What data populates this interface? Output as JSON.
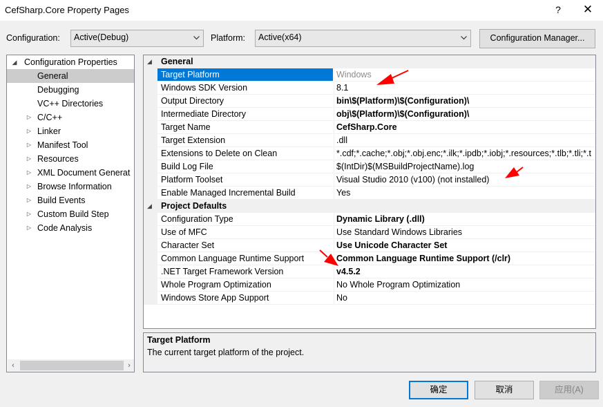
{
  "window": {
    "title": "CefSharp.Core Property Pages",
    "help_label": "?",
    "close_label": "✕"
  },
  "toolbar": {
    "configuration_label": "Configuration:",
    "configuration_value": "Active(Debug)",
    "platform_label": "Platform:",
    "platform_value": "Active(x64)",
    "config_manager_label": "Configuration Manager..."
  },
  "tree": {
    "root": "Configuration Properties",
    "items": [
      {
        "label": "General",
        "selected": true,
        "expandable": false
      },
      {
        "label": "Debugging",
        "expandable": false
      },
      {
        "label": "VC++ Directories",
        "expandable": false
      },
      {
        "label": "C/C++",
        "expandable": true
      },
      {
        "label": "Linker",
        "expandable": true
      },
      {
        "label": "Manifest Tool",
        "expandable": true
      },
      {
        "label": "Resources",
        "expandable": true
      },
      {
        "label": "XML Document Generat",
        "expandable": true
      },
      {
        "label": "Browse Information",
        "expandable": true
      },
      {
        "label": "Build Events",
        "expandable": true
      },
      {
        "label": "Custom Build Step",
        "expandable": true
      },
      {
        "label": "Code Analysis",
        "expandable": true
      }
    ]
  },
  "grid": {
    "categories": [
      {
        "name": "General",
        "rows": [
          {
            "name": "Target Platform",
            "value": "Windows",
            "style": "dim",
            "selected": true
          },
          {
            "name": "Windows SDK Version",
            "value": "8.1"
          },
          {
            "name": "Output Directory",
            "value": "bin\\$(Platform)\\$(Configuration)\\",
            "style": "bold"
          },
          {
            "name": "Intermediate Directory",
            "value": "obj\\$(Platform)\\$(Configuration)\\",
            "style": "bold"
          },
          {
            "name": "Target Name",
            "value": "CefSharp.Core",
            "style": "bold"
          },
          {
            "name": "Target Extension",
            "value": ".dll"
          },
          {
            "name": "Extensions to Delete on Clean",
            "value": "*.cdf;*.cache;*.obj;*.obj.enc;*.ilk;*.ipdb;*.iobj;*.resources;*.tlb;*.tli;*.t"
          },
          {
            "name": "Build Log File",
            "value": "$(IntDir)$(MSBuildProjectName).log"
          },
          {
            "name": "Platform Toolset",
            "value": "Visual Studio 2010 (v100) (not installed)"
          },
          {
            "name": "Enable Managed Incremental Build",
            "value": "Yes"
          }
        ]
      },
      {
        "name": "Project Defaults",
        "rows": [
          {
            "name": "Configuration Type",
            "value": "Dynamic Library (.dll)",
            "style": "bold"
          },
          {
            "name": "Use of MFC",
            "value": "Use Standard Windows Libraries"
          },
          {
            "name": "Character Set",
            "value": "Use Unicode Character Set",
            "style": "bold"
          },
          {
            "name": "Common Language Runtime Support",
            "value": "Common Language Runtime Support (/clr)",
            "style": "bold"
          },
          {
            "name": ".NET Target Framework Version",
            "value": "v4.5.2",
            "style": "bold"
          },
          {
            "name": "Whole Program Optimization",
            "value": "No Whole Program Optimization"
          },
          {
            "name": "Windows Store App Support",
            "value": "No"
          }
        ]
      }
    ]
  },
  "description": {
    "title": "Target Platform",
    "text": "The current target platform of the project."
  },
  "buttons": {
    "ok": "确定",
    "cancel": "取消",
    "apply": "应用(A)"
  },
  "colors": {
    "selection": "#0078d7",
    "annotation_arrow": "#ff0000"
  }
}
